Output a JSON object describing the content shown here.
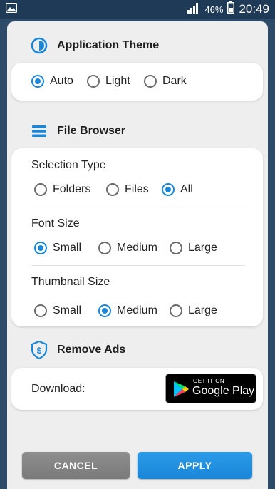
{
  "status_bar": {
    "battery": "46%",
    "time": "20:49"
  },
  "theme_section": {
    "title": "Application Theme",
    "icon": "theme-icon",
    "options": [
      "Auto",
      "Light",
      "Dark"
    ],
    "selected": "Auto"
  },
  "file_browser": {
    "title": "File Browser",
    "icon": "menu-icon",
    "selection_type": {
      "label": "Selection Type",
      "options": [
        "Folders",
        "Files",
        "All"
      ],
      "selected": "All"
    },
    "font_size": {
      "label": "Font Size",
      "options": [
        "Small",
        "Medium",
        "Large"
      ],
      "selected": "Small"
    },
    "thumbnail_size": {
      "label": "Thumbnail Size",
      "options": [
        "Small",
        "Medium",
        "Large"
      ],
      "selected": "Medium"
    }
  },
  "remove_ads": {
    "title": "Remove Ads",
    "icon": "dollar-shield-icon",
    "download_label": "Download:",
    "badge_top": "GET IT ON",
    "badge_main": "Google Play"
  },
  "buttons": {
    "cancel": "CANCEL",
    "apply": "APPLY"
  },
  "colors": {
    "accent": "#1a86d8",
    "cancel": "#808080"
  }
}
